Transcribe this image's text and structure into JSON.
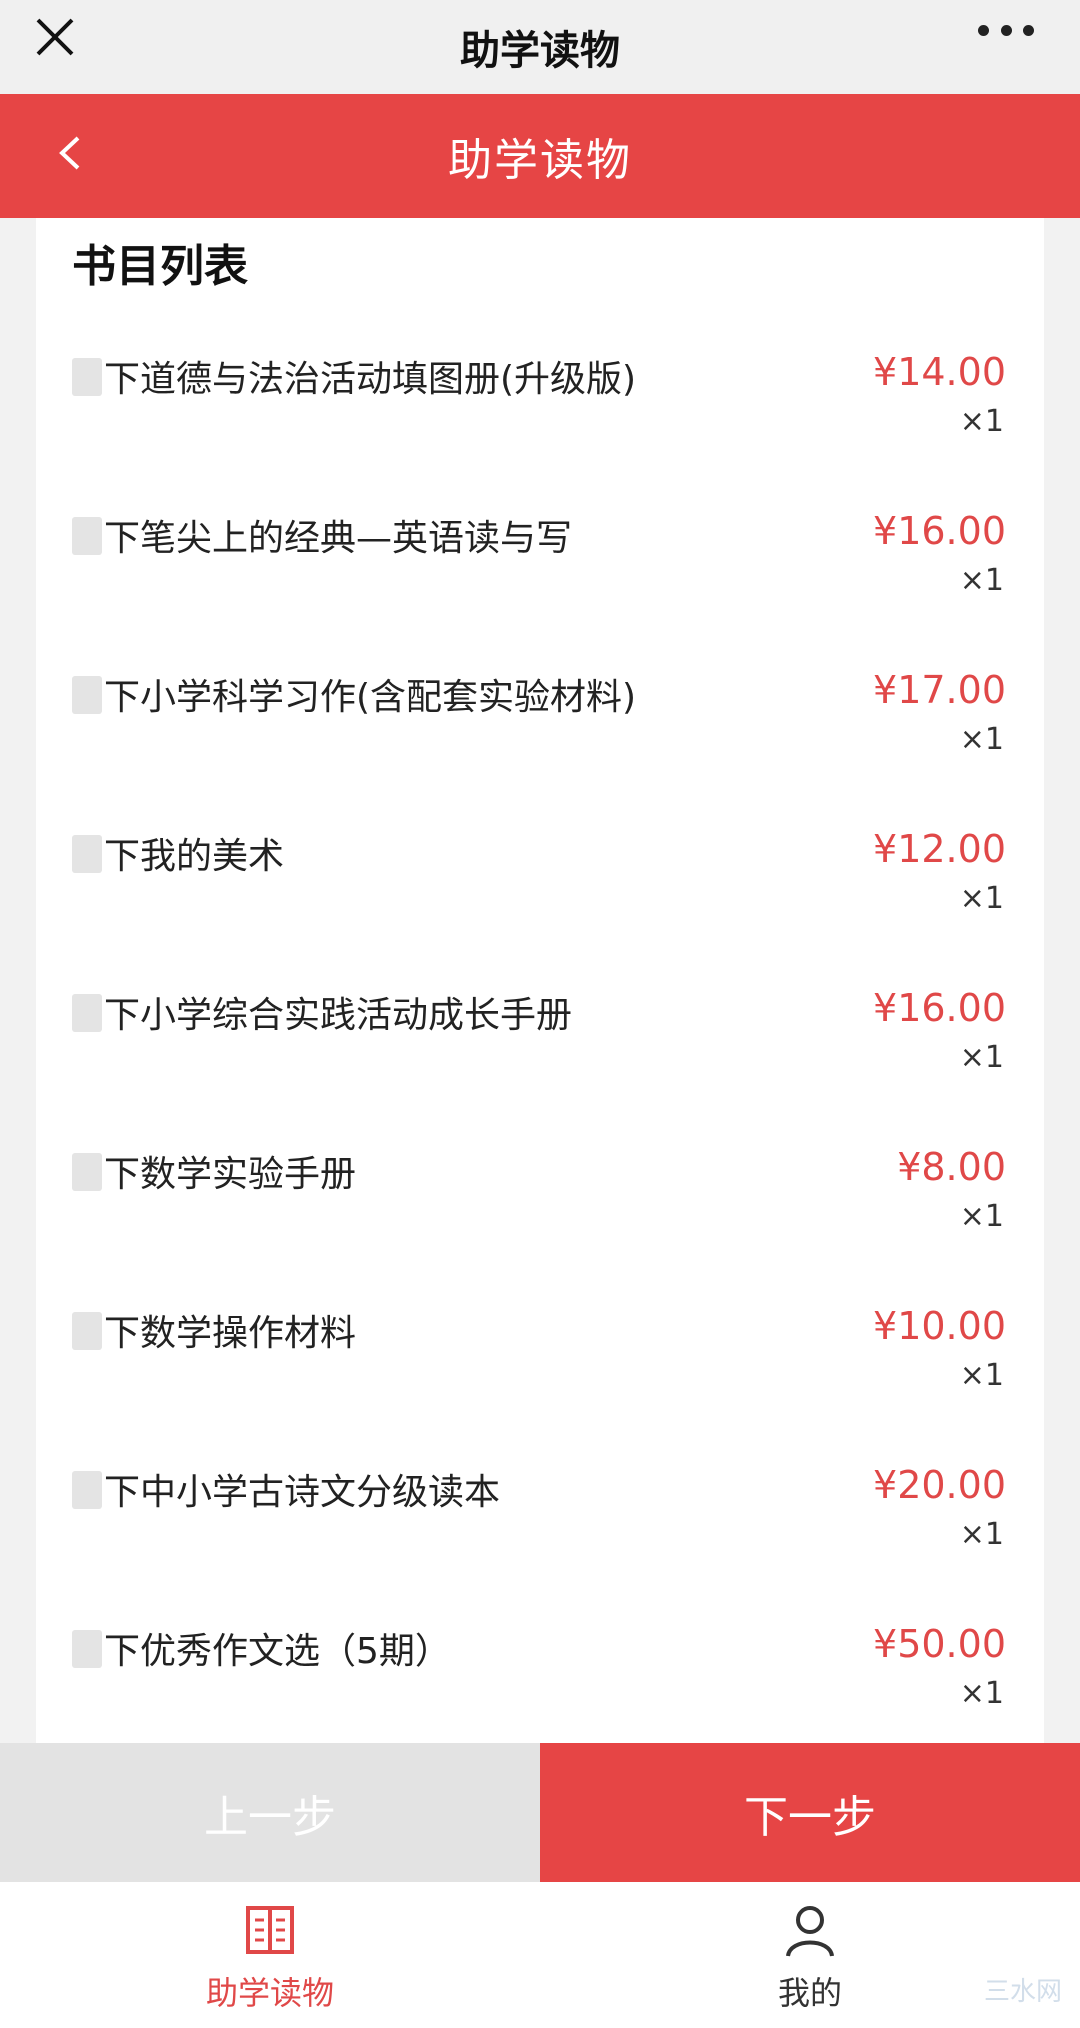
{
  "topbar": {
    "title": "助学读物"
  },
  "header": {
    "title": "助学读物"
  },
  "section": {
    "title": "书目列表"
  },
  "books": [
    {
      "name": "下道德与法治活动填图册(升级版)",
      "price": "¥14.00",
      "qty": "×1"
    },
    {
      "name": "下笔尖上的经典—英语读与写",
      "price": "¥16.00",
      "qty": "×1"
    },
    {
      "name": "下小学科学习作(含配套实验材料)",
      "price": "¥17.00",
      "qty": "×1"
    },
    {
      "name": "下我的美术",
      "price": "¥12.00",
      "qty": "×1"
    },
    {
      "name": "下小学综合实践活动成长手册",
      "price": "¥16.00",
      "qty": "×1"
    },
    {
      "name": "下数学实验手册",
      "price": "¥8.00",
      "qty": "×1"
    },
    {
      "name": "下数学操作材料",
      "price": "¥10.00",
      "qty": "×1"
    },
    {
      "name": "下中小学古诗文分级读本",
      "price": "¥20.00",
      "qty": "×1"
    },
    {
      "name": "下优秀作文选（5期）",
      "price": "¥50.00",
      "qty": "×1"
    }
  ],
  "steps": {
    "prev_label": "上一步",
    "next_label": "下一步"
  },
  "tabbar": {
    "tabs": [
      {
        "label": "助学读物",
        "icon": "book-icon",
        "active": true
      },
      {
        "label": "我的",
        "icon": "user-icon",
        "active": false
      }
    ]
  },
  "watermark": "三水网",
  "colors": {
    "accent": "#e64545",
    "price": "#e04848",
    "prev_button": "#e3e3e3"
  }
}
